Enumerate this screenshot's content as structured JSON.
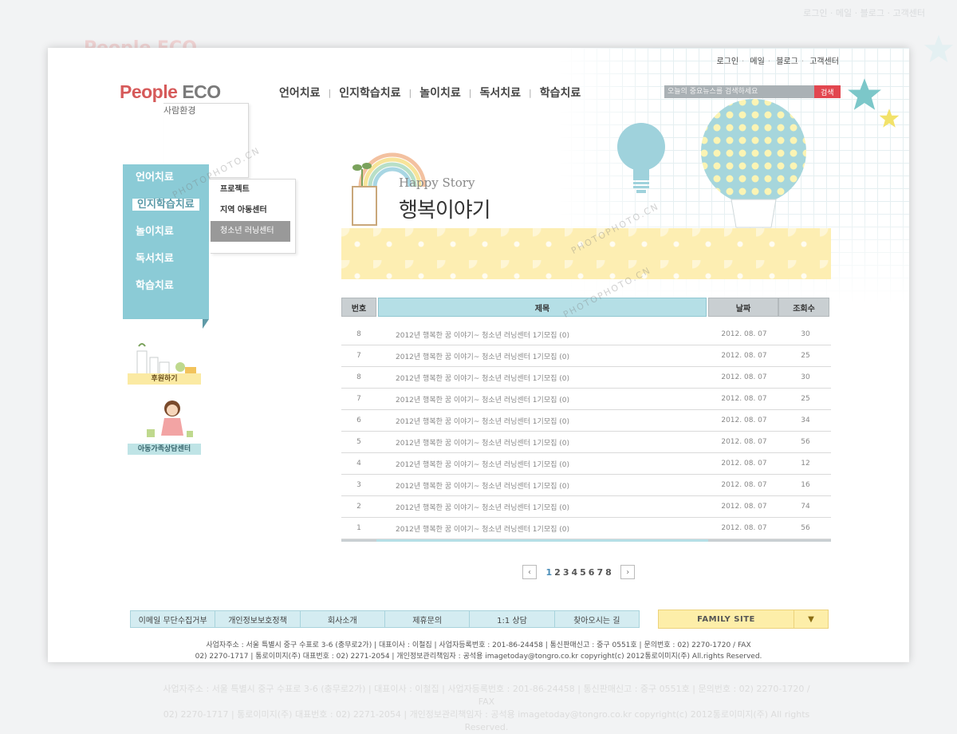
{
  "ghost": {
    "logo": "People ECO",
    "util": "로그인 · 메일 · 블로그 · 고객센터",
    "footer_lines": [
      "사업자주소 : 서울 특별시 중구 수표로 3-6 (충무로2가) | 대표이사 : 이철집 | 사업자등록번호 : 201-86-24458 | 통신판매신고 : 중구 0551호 | 문의번호 : 02) 2270-1720 / FAX",
      "02) 2270-1717 | 통로이미지(주) 대표번호 : 02) 2271-2054 | 개인정보관리책임자 : 공석용 imagetoday@tongro.co.kr copyright(c) 2012통로이미지(주) All rights Reserved."
    ]
  },
  "util": {
    "items": [
      "로그인",
      "메일",
      "블로그",
      "고객센터"
    ]
  },
  "logo": {
    "brand_a": "People",
    "brand_b": "ECO",
    "sub": "사람환경"
  },
  "gnb": {
    "items": [
      "언어치료",
      "인지학습치료",
      "놀이치료",
      "독서치료",
      "학습치료"
    ]
  },
  "search": {
    "placeholder": "오늘의 중요뉴스를 검색하세요",
    "button": "검색"
  },
  "lnb": {
    "items": [
      "언어치료",
      "인지학습치료",
      "놀이치료",
      "독서치료",
      "학습치료"
    ],
    "selected": 1
  },
  "submenu": {
    "items": [
      "프로젝트",
      "지역 아동센터",
      "청소년 러닝센터"
    ],
    "selected": 2
  },
  "banners": {
    "support": "후원하기",
    "counsel": "아동가족상담센터"
  },
  "heading": {
    "en": "Happy Story",
    "ko": "행복이야기"
  },
  "table": {
    "headers": {
      "no": "번호",
      "title": "제목",
      "date": "날짜",
      "views": "조회수"
    },
    "rows": [
      {
        "no": "8",
        "title": "2012년 행복한 꿈 이야기~ 청소년 러닝센터 1기모집 (0)",
        "date": "2012. 08. 07",
        "views": "30"
      },
      {
        "no": "7",
        "title": "2012년 행복한 꿈 이야기~ 청소년 러닝센터 1기모집 (0)",
        "date": "2012. 08. 07",
        "views": "25"
      },
      {
        "no": "8",
        "title": "2012년 행복한 꿈 이야기~ 청소년 러닝센터 1기모집 (0)",
        "date": "2012. 08. 07",
        "views": "30"
      },
      {
        "no": "7",
        "title": "2012년 행복한 꿈 이야기~ 청소년 러닝센터 1기모집 (0)",
        "date": "2012. 08. 07",
        "views": "25"
      },
      {
        "no": "6",
        "title": "2012년 행복한 꿈 이야기~ 청소년 러닝센터 1기모집 (0)",
        "date": "2012. 08. 07",
        "views": "34"
      },
      {
        "no": "5",
        "title": "2012년 행복한 꿈 이야기~ 청소년 러닝센터 1기모집 (0)",
        "date": "2012. 08. 07",
        "views": "56"
      },
      {
        "no": "4",
        "title": "2012년 행복한 꿈 이야기~ 청소년 러닝센터 1기모집 (0)",
        "date": "2012. 08. 07",
        "views": "12"
      },
      {
        "no": "3",
        "title": "2012년 행복한 꿈 이야기~ 청소년 러닝센터 1기모집 (0)",
        "date": "2012. 08. 07",
        "views": "16"
      },
      {
        "no": "2",
        "title": "2012년 행복한 꿈 이야기~ 청소년 러닝센터 1기모집 (0)",
        "date": "2012. 08. 07",
        "views": "74"
      },
      {
        "no": "1",
        "title": "2012년 행복한 꿈 이야기~ 청소년 러닝센터 1기모집 (0)",
        "date": "2012. 08. 07",
        "views": "56"
      }
    ]
  },
  "pager": {
    "prev": "‹",
    "next": "›",
    "pages": [
      "1",
      "2",
      "3",
      "4",
      "5",
      "6",
      "7",
      "8"
    ],
    "current": "1"
  },
  "footer_nav": {
    "items": [
      "이메일 무단수집거부",
      "개인정보보호정책",
      "회사소개",
      "제휴문의",
      "1:1 상담",
      "찾아오시는 길"
    ]
  },
  "family_site": {
    "label": "FAMILY SITE",
    "arrow": "▼"
  },
  "address": {
    "line1": "사업자주소 : 서울 특별시 중구 수표로 3-6 (충무로2가) | 대표이사 : 이철집 | 사업자등록번호 : 201-86-24458 | 통신판매신고 : 중구 0551호 | 문의번호 : 02) 2270-1720 / FAX",
    "line2": "02) 2270-1717 | 통로이미지(주) 대표번호 : 02) 2271-2054 | 개인정보관리책임자 : 공석용 imagetoday@tongro.co.kr  copyright(c) 2012통로이미지(주) All.rights Reserved."
  },
  "watermark": "PHOTOPHOTO.CN",
  "colors": {
    "accent_teal": "#8bcbd6",
    "search_red": "#e2464f",
    "brand_red": "#d65a5a",
    "pattern_yellow": "#fdeeb2"
  }
}
